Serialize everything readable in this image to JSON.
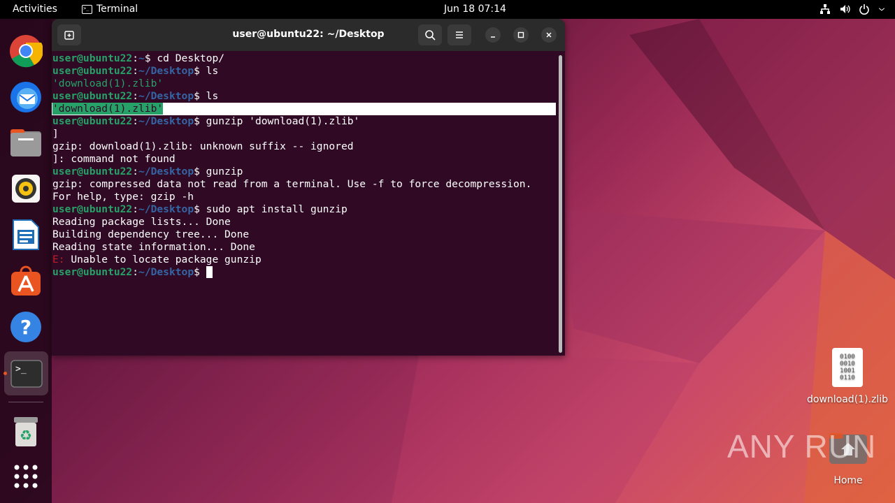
{
  "topbar": {
    "activities": "Activities",
    "app_name": "Terminal",
    "clock": "Jun 18  07:14",
    "tray_icons": [
      "network-icon",
      "volume-icon",
      "power-icon"
    ]
  },
  "dock": {
    "items": [
      "chrome-icon",
      "thunderbird-icon",
      "files-icon",
      "rhythmbox-icon",
      "libreoffice-writer-icon",
      "app-center-icon",
      "help-icon",
      "terminal-icon",
      "trash-icon",
      "show-apps-icon"
    ],
    "active": "terminal-icon"
  },
  "terminal": {
    "title": "user@ubuntu22: ~/Desktop",
    "prompt_user": "user@ubuntu22",
    "lines": [
      {
        "path": "~",
        "cmd": "cd Desktop/"
      },
      {
        "path": "~/Desktop",
        "cmd": "ls"
      },
      {
        "out": "'download(1).zlib'"
      },
      {
        "path": "~/Desktop",
        "cmd": "ls"
      },
      {
        "out": "'download(1).zlib'"
      },
      {
        "path": "~/Desktop",
        "cmd": "gunzip 'download(1).zlib'"
      },
      {
        "out": "]"
      },
      {
        "out": "gzip: download(1).zlib: unknown suffix -- ignored"
      },
      {
        "out": "]: command not found"
      },
      {
        "path": "~/Desktop",
        "cmd": "gunzip"
      },
      {
        "out": "gzip: compressed data not read from a terminal. Use -f to force decompression."
      },
      {
        "out": "For help, type: gzip -h"
      },
      {
        "path": "~/Desktop",
        "cmd": "sudo apt install gunzip"
      },
      {
        "out": "Reading package lists... Done"
      },
      {
        "out": "Building dependency tree... Done"
      },
      {
        "out": "Reading state information... Done"
      },
      {
        "err_prefix": "E:",
        "out": " Unable to locate package gunzip"
      },
      {
        "path": "~/Desktop",
        "cmd": ""
      }
    ]
  },
  "desktop": {
    "file_label": "download(1).zlib",
    "file_glyph": "0100\n0010\n1001\n0110",
    "home_label": "Home",
    "watermark": "ANY RUN"
  },
  "colors": {
    "terminal_bg": "#300a24",
    "prompt_green": "#26a269",
    "prompt_blue": "#3465a4",
    "error_red": "#c01c28",
    "accent": "#e95420"
  }
}
